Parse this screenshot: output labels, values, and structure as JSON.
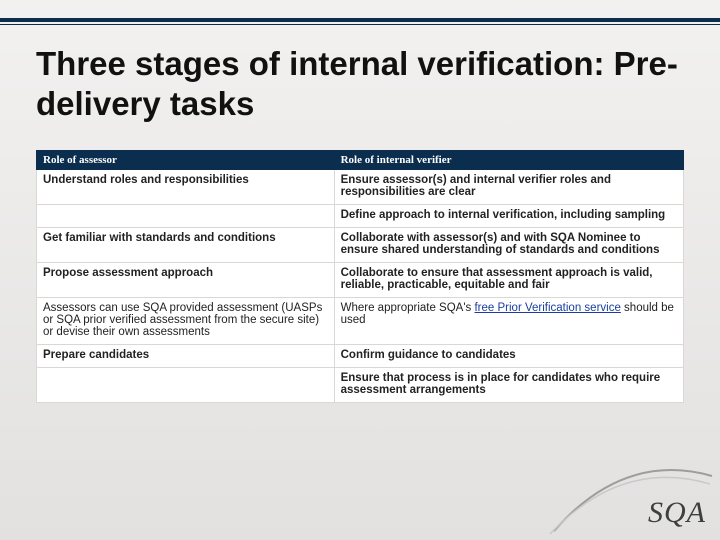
{
  "title": "Three stages of internal verification: Pre-delivery tasks",
  "table": {
    "headers": {
      "assessor": "Role of assessor",
      "verifier": "Role of internal verifier"
    },
    "rows": [
      {
        "assessor": "Understand roles and responsibilities",
        "verifier": "Ensure assessor(s) and internal verifier roles and responsibilities are clear"
      },
      {
        "assessor": "",
        "verifier": "Define approach to internal verification, including sampling"
      },
      {
        "assessor": "Get familiar with standards and conditions",
        "verifier": "Collaborate with assessor(s) and with SQA Nominee to ensure shared understanding of standards and conditions"
      },
      {
        "assessor": "Propose assessment approach",
        "verifier": "Collaborate to ensure that assessment approach is valid, reliable, practicable, equitable and fair"
      },
      {
        "assessor": "Assessors can use SQA provided assessment (UASPs or SQA prior verified assessment from the secure site) or devise their own assessments",
        "verifier_pre": "Where appropriate SQA's ",
        "verifier_link": "free Prior Verification service",
        "verifier_post": " should be used"
      },
      {
        "assessor": "Prepare candidates",
        "verifier": "Confirm guidance to candidates"
      },
      {
        "assessor": "",
        "verifier": "Ensure that process is in place for candidates who require assessment arrangements"
      }
    ]
  },
  "logo": {
    "text": "SQA"
  }
}
